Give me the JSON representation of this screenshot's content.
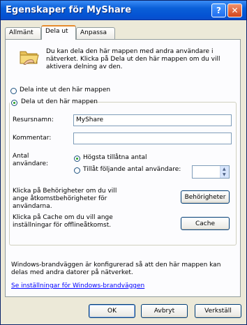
{
  "window": {
    "title": "Egenskaper för MyShare",
    "help_glyph": "?",
    "close_glyph": "✕"
  },
  "tabs": [
    {
      "label": "Allmänt"
    },
    {
      "label": "Dela ut"
    },
    {
      "label": "Anpassa"
    }
  ],
  "sharing": {
    "intro": "Du kan dela den här mappen med andra användare i nätverket. Klicka på Dela ut den här mappen om du vill aktivera delning av den.",
    "option_no_share": "Dela inte ut den här mappen",
    "option_share": "Dela ut den här mappen",
    "share_name_label": "Resursnamn:",
    "share_name_value": "MyShare",
    "comment_label": "Kommentar:",
    "comment_value": "",
    "user_limit_label": "Antal användare:",
    "max_allowed": "Högsta tillåtna antal",
    "allow_users": "Tillåt följande antal användare:",
    "permissions_text": "Klicka på Behörigheter om du vill ange åtkomstbehörigheter för användarna.",
    "permissions_button": "Behörigheter",
    "cache_text": "Klicka på Cache om du vill ange inställningar för offlineåtkomst.",
    "cache_button": "Cache",
    "firewall_text": "Windows-brandväggen är konfigurerad så att den här mappen kan delas med andra datorer på nätverket.",
    "firewall_link": "Se inställningar för Windows-brandväggen"
  },
  "footer": {
    "ok": "OK",
    "cancel": "Avbryt",
    "apply": "Verkställ"
  },
  "icons": {
    "folder": "folder-share-icon",
    "spin_up": "▲",
    "spin_down": "▼"
  }
}
